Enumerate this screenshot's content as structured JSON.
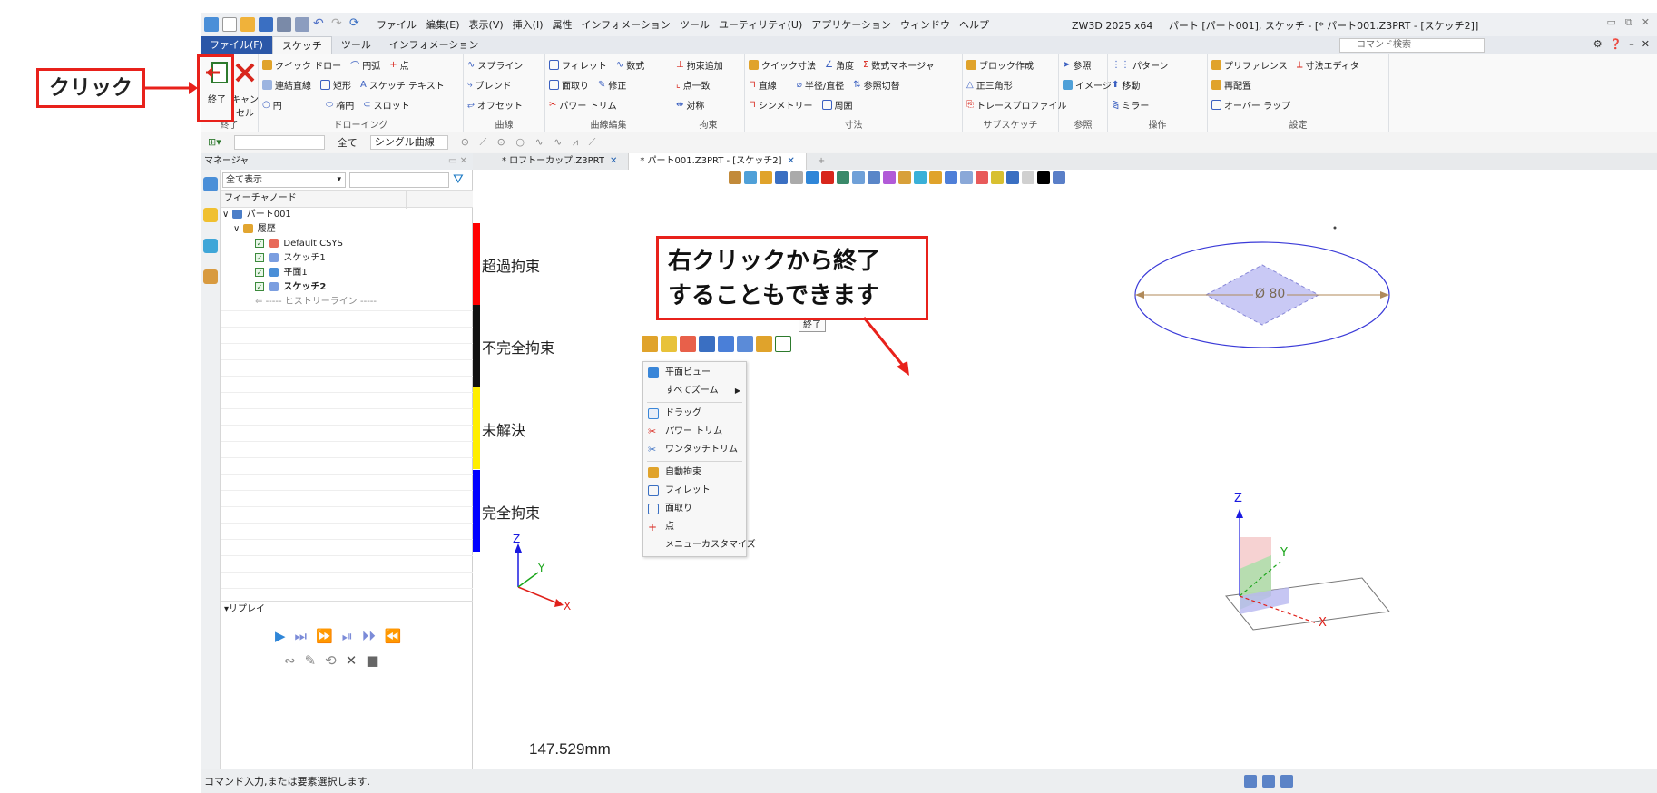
{
  "annotations": {
    "click_label": "クリック",
    "callout_line1": "右クリックから終了",
    "callout_line2": "することもできます"
  },
  "colors": {
    "annotation_red": "#e8211b",
    "file_tab": "#2b57a8",
    "over_constrained": "#ff0000",
    "under_constrained": "#111111",
    "unsolved": "#ffee00",
    "fully_constrained": "#0000ff"
  },
  "titlebar": {
    "menus": [
      "ファイル",
      "編集(E)",
      "表示(V)",
      "挿入(I)",
      "属性",
      "インフォメーション",
      "ツール",
      "ユーティリティ(U)",
      "アプリケーション",
      "ウィンドウ",
      "ヘルプ"
    ],
    "app_title": "ZW3D 2025 x64",
    "doc_title": "パート [パート001], スケッチ - [* パート001.Z3PRT - [スケッチ2]]"
  },
  "ribbon_tabs": {
    "file": "ファイル(F)",
    "sketch": "スケッチ",
    "tools": "ツール",
    "info": "インフォメーション",
    "search_placeholder": "コマンド検索"
  },
  "ribbon": {
    "end_label": "終了",
    "cancel_label": "キャンセル",
    "group_end": "終了",
    "drawing": {
      "quick_draw": "クイック ドロー",
      "arc": "円弧",
      "point": "点",
      "polyline": "連結直線",
      "rectangle": "矩形",
      "sketch_text": "スケッチ テキスト",
      "circle": "円",
      "ellipse": "楕円",
      "slot": "スロット",
      "label": "ドローイング"
    },
    "curve": {
      "spline": "スプライン",
      "blend": "ブレンド",
      "offset": "オフセット",
      "label": "曲線"
    },
    "curve_edit": {
      "fillet": "フィレット",
      "chamfer": "面取り",
      "power_trim": "パワー トリム",
      "formula": "数式",
      "modify": "修正",
      "label": "曲線編集"
    },
    "constraint": {
      "add": "拘束追加",
      "coincident": "点一致",
      "symmetric": "対称",
      "label": "拘束"
    },
    "dimension": {
      "quick": "クイック寸法",
      "angle": "角度",
      "linear": "直線",
      "radius": "半径/直径",
      "symmetry": "シンメトリー",
      "perimeter": "周囲",
      "formula_manager": "数式マネージャ",
      "ref_toggle": "参照切替",
      "label": "寸法"
    },
    "subsketch": {
      "block": "ブロック作成",
      "triangle": "正三角形",
      "trace": "トレースプロファイル",
      "label": "サブスケッチ"
    },
    "reference": {
      "ref": "参照",
      "image": "イメージ",
      "label": "参照"
    },
    "operation": {
      "pattern": "パターン",
      "move": "移動",
      "mirror": "ミラー",
      "preference": "プリファレンス",
      "relayout": "再配置",
      "overlap": "オーバー ラップ",
      "label": "操作"
    },
    "settings": {
      "dim_editor": "寸法エディタ",
      "label": "設定"
    }
  },
  "subtool": {
    "all": "全て",
    "single_curve": "シングル曲線"
  },
  "manager": {
    "title": "マネージャ",
    "show_all": "全て表示",
    "tree_header": "フィーチャノード",
    "tree": {
      "part": "パート001",
      "history": "履歴",
      "csys": "Default CSYS",
      "sketch1": "スケッチ1",
      "plane1": "平面1",
      "sketch2": "スケッチ2",
      "history_line": "----- ヒストリーライン -----"
    },
    "replay": "リプレイ"
  },
  "viewport": {
    "tab1": "* ロフトーカップ.Z3PRT",
    "tab2": "* パート001.Z3PRT - [スケッチ2]",
    "legend": [
      "超過拘束",
      "不完全拘束",
      "未解決",
      "完全拘束"
    ],
    "dimension": "Ø 80",
    "scale": "147.529mm",
    "tooltip": "終了"
  },
  "context_menu": {
    "items": [
      "平面ビュー",
      "すべてズーム",
      "ドラッグ",
      "パワー トリム",
      "ワンタッチトリム",
      "自動拘束",
      "フィレット",
      "面取り",
      "点",
      "メニューカスタマイズ"
    ]
  },
  "status": {
    "message": "コマンド入力,または要素選択します."
  }
}
